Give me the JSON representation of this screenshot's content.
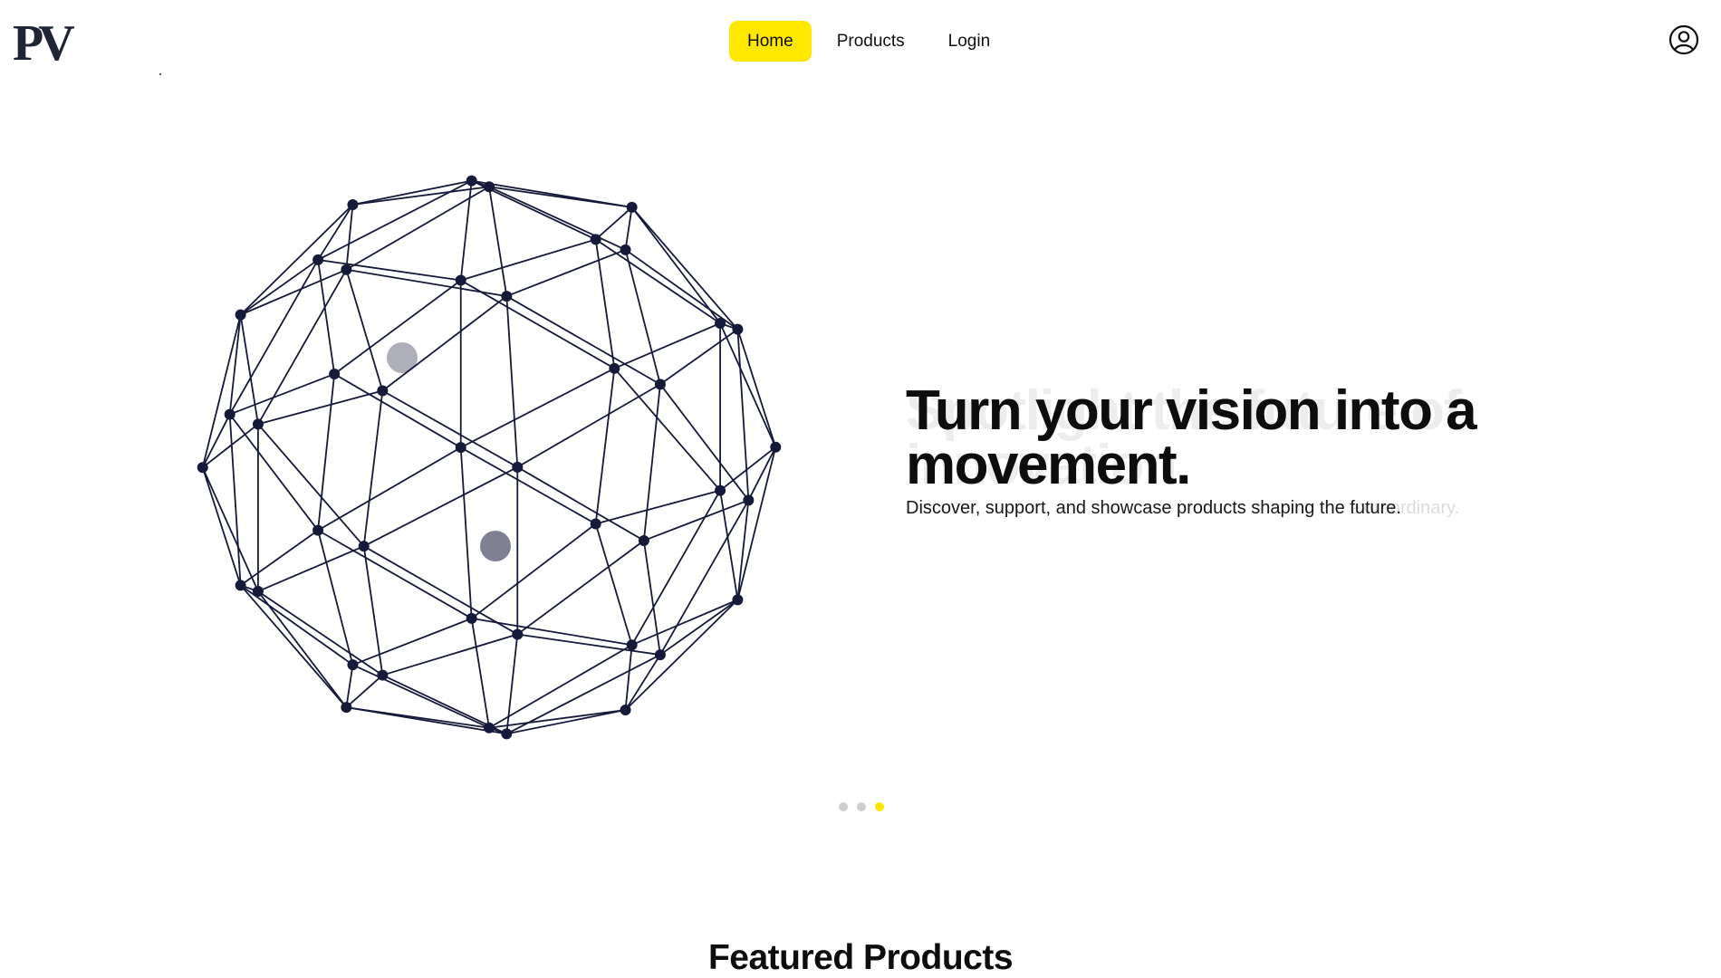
{
  "header": {
    "logo_text": "PV",
    "nav": [
      {
        "label": "Home",
        "active": true
      },
      {
        "label": "Products",
        "active": false
      },
      {
        "label": "Login",
        "active": false
      }
    ],
    "account_icon": "user-circle-icon"
  },
  "hero": {
    "ghost_title": "Spotlight the future of innovation.",
    "title": "Turn your vision into a movement.",
    "ghost_subtitle": "Discover, support, and showcase products shaping the extraordinary.",
    "subtitle": "Discover, support, and showcase products shaping the future.",
    "illustration_icon": "network-sphere-icon",
    "carousel": {
      "count": 3,
      "active_index": 2
    }
  },
  "featured": {
    "title": "Featured Products"
  },
  "colors": {
    "accent": "#ffe800",
    "ink": "#161a3a",
    "text": "#111111"
  }
}
